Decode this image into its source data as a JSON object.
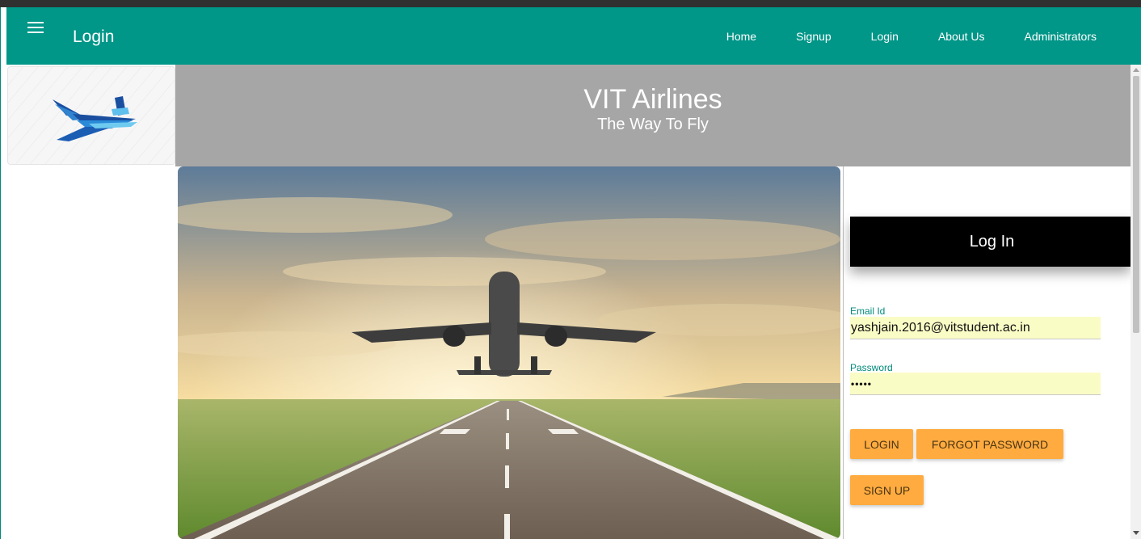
{
  "navbar": {
    "title": "Login",
    "menu_icon": "hamburger-menu-icon",
    "links": [
      "Home",
      "Signup",
      "Login",
      "About Us",
      "Administrators"
    ]
  },
  "logo": {
    "icon": "airplane-logo-icon"
  },
  "banner": {
    "title": "VIT Airlines",
    "subtitle": "The Way To Fly"
  },
  "hero": {
    "image": "airplane-takeoff-runway-photo"
  },
  "login": {
    "header": "Log In",
    "email_label": "Email Id",
    "email_value": "yashjain.2016@vitstudent.ac.in",
    "password_label": "Password",
    "password_value": "•••••",
    "login_button": "LOGIN",
    "forgot_button": "FORGOT PASSWORD",
    "signup_button": "SIGN UP"
  },
  "colors": {
    "navbar": "#009688",
    "banner": "#a6a6a6",
    "button": "#ffab40",
    "input_bg": "#fafcc6",
    "label": "#00897b",
    "login_header": "#000000"
  }
}
